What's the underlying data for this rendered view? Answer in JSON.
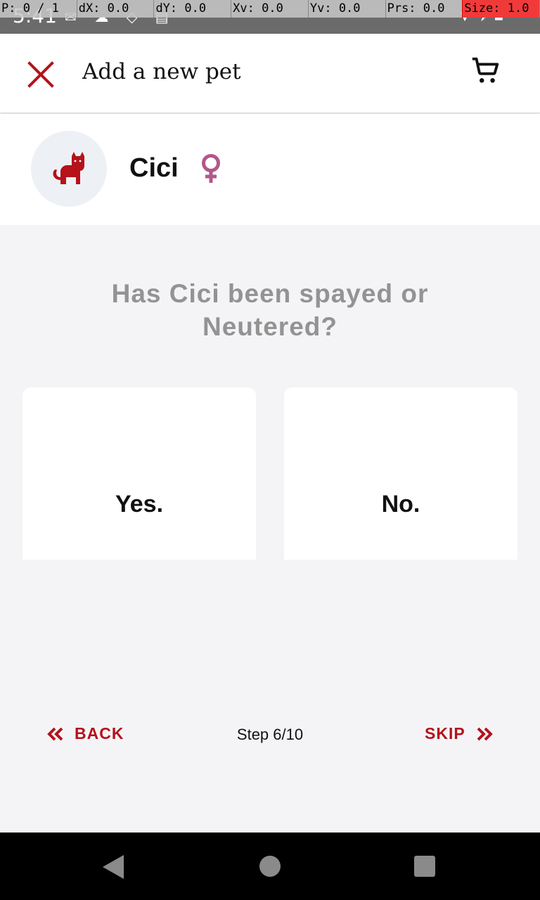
{
  "status_bar": {
    "time": "5:41"
  },
  "pointer_overlay": {
    "p": "P: 0 / 1",
    "dx": "dX: 0.0",
    "dy": "dY: 0.0",
    "xv": "Xv: 0.0",
    "yv": "Yv: 0.0",
    "prs": "Prs: 0.0",
    "size": "Size: 1.0"
  },
  "app_bar": {
    "title": "Add a new pet",
    "close_icon": "close-icon",
    "cart_icon": "cart-icon"
  },
  "pet": {
    "name": "Cici",
    "avatar_icon": "cat-icon",
    "sex_icon": "female-icon"
  },
  "question": "Has Cici been spayed or Neutered?",
  "options": {
    "yes": "Yes.",
    "no": "No."
  },
  "footer": {
    "back_label": "BACK",
    "skip_label": "SKIP",
    "step": "Step 6/10"
  },
  "colors": {
    "accent": "#b5121b",
    "female": "#b3578a",
    "question": "#939393"
  }
}
